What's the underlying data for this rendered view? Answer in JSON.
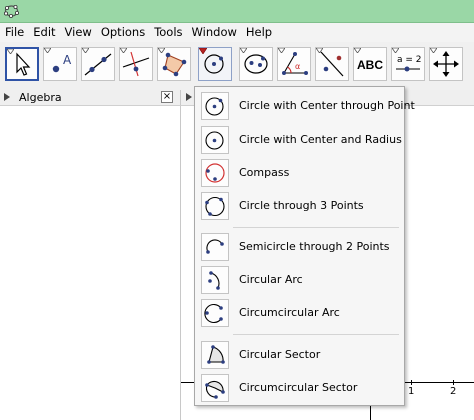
{
  "menu": [
    "File",
    "Edit",
    "View",
    "Options",
    "Tools",
    "Window",
    "Help"
  ],
  "toolbar": {
    "tools": [
      {
        "icon": "move-arrow-icon"
      },
      {
        "icon": "new-point-icon",
        "label": "A"
      },
      {
        "icon": "line-through-points-icon"
      },
      {
        "icon": "perpendicular-line-icon"
      },
      {
        "icon": "polygon-icon"
      },
      {
        "icon": "circle-center-point-icon"
      },
      {
        "icon": "ellipse-icon"
      },
      {
        "icon": "angle-icon",
        "label": "α"
      },
      {
        "icon": "reflect-line-icon"
      },
      {
        "icon": "text-icon",
        "label": "ABC"
      },
      {
        "icon": "slider-icon",
        "label": "a = 2"
      },
      {
        "icon": "move-view-icon"
      }
    ]
  },
  "algebra_panel": {
    "title": "Algebra",
    "close": "×"
  },
  "graphics": {
    "tick_labels": [
      "1",
      "2"
    ]
  },
  "dropdown": {
    "groups": [
      [
        {
          "label": "Circle with Center through Point",
          "icon": "circle-center-point-icon"
        },
        {
          "label": "Circle with Center and Radius",
          "icon": "circle-center-radius-icon"
        },
        {
          "label": "Compass",
          "icon": "compass-icon"
        },
        {
          "label": "Circle through 3 Points",
          "icon": "circle-three-points-icon"
        }
      ],
      [
        {
          "label": "Semicircle through 2 Points",
          "icon": "semicircle-icon"
        },
        {
          "label": "Circular Arc",
          "icon": "circular-arc-icon"
        },
        {
          "label": "Circumcircular Arc",
          "icon": "circumcircular-arc-icon"
        }
      ],
      [
        {
          "label": "Circular Sector",
          "icon": "circular-sector-icon"
        },
        {
          "label": "Circumcircular Sector",
          "icon": "circumcircular-sector-icon"
        }
      ]
    ]
  },
  "colors": {
    "titlebar": "#9ad7a6",
    "selection": "#2f53a6",
    "point": "#2c3e80",
    "accent_red": "#d33333"
  }
}
